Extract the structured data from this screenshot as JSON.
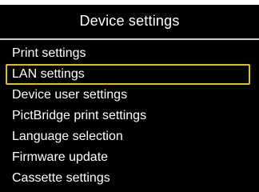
{
  "header": {
    "title": "Device settings"
  },
  "menu": {
    "items": [
      {
        "label": "Print settings",
        "selected": false
      },
      {
        "label": "LAN settings",
        "selected": true
      },
      {
        "label": "Device user settings",
        "selected": false
      },
      {
        "label": "PictBridge print settings",
        "selected": false
      },
      {
        "label": "Language selection",
        "selected": false
      },
      {
        "label": "Firmware update",
        "selected": false
      },
      {
        "label": "Cassette settings",
        "selected": false
      }
    ]
  },
  "colors": {
    "background": "#000000",
    "text": "#ffffff",
    "selection_border": "#d8c21a",
    "divider": "#cfcfcf"
  }
}
